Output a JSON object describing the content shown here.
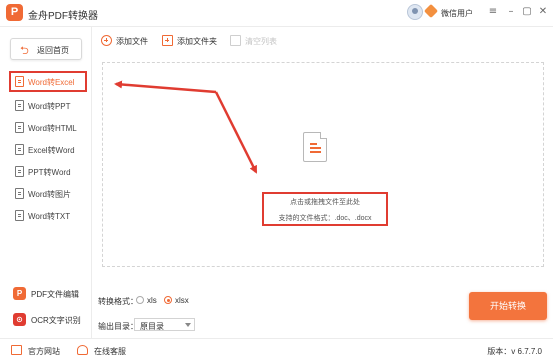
{
  "app": {
    "logo_letter": "P",
    "title": "金舟PDF转换器"
  },
  "user": {
    "name": "微信用户"
  },
  "window_controls": {
    "menu": "≡",
    "minimize": "–",
    "restore": "▢",
    "close": "✕"
  },
  "sidebar": {
    "back_label": "返回首页",
    "items": [
      {
        "label": "Word转Excel",
        "active": true
      },
      {
        "label": "Word转PPT"
      },
      {
        "label": "Word转HTML"
      },
      {
        "label": "Excel转Word"
      },
      {
        "label": "PPT转Word"
      },
      {
        "label": "Word转图片"
      },
      {
        "label": "Word转TXT"
      }
    ],
    "tools": [
      {
        "label": "PDF文件编辑",
        "icon": "pdf-edit-icon",
        "icon_letter": "P",
        "color": "#f06a35"
      },
      {
        "label": "OCR文字识别",
        "icon": "ocr-icon",
        "icon_letter": "⊙",
        "color": "#e03c31"
      }
    ]
  },
  "toolbar": {
    "add_file": "添加文件",
    "add_folder": "添加文件夹",
    "clear_list": "清空列表"
  },
  "dropzone": {
    "hint": "点击或拖拽文件至此处",
    "formats": "支持的文件格式：.doc、.docx"
  },
  "options": {
    "format_label": "转换格式：",
    "formats": [
      "xls",
      "xlsx"
    ],
    "selected_format": "xlsx",
    "output_label": "输出目录：",
    "output_value": "原目录"
  },
  "start_button": "开始转换",
  "status": {
    "website": "官方网站",
    "support": "在线客服",
    "version": "版本：v 6.7.7.0"
  },
  "colors": {
    "accent": "#f06a35",
    "annotation": "#e03c31"
  }
}
